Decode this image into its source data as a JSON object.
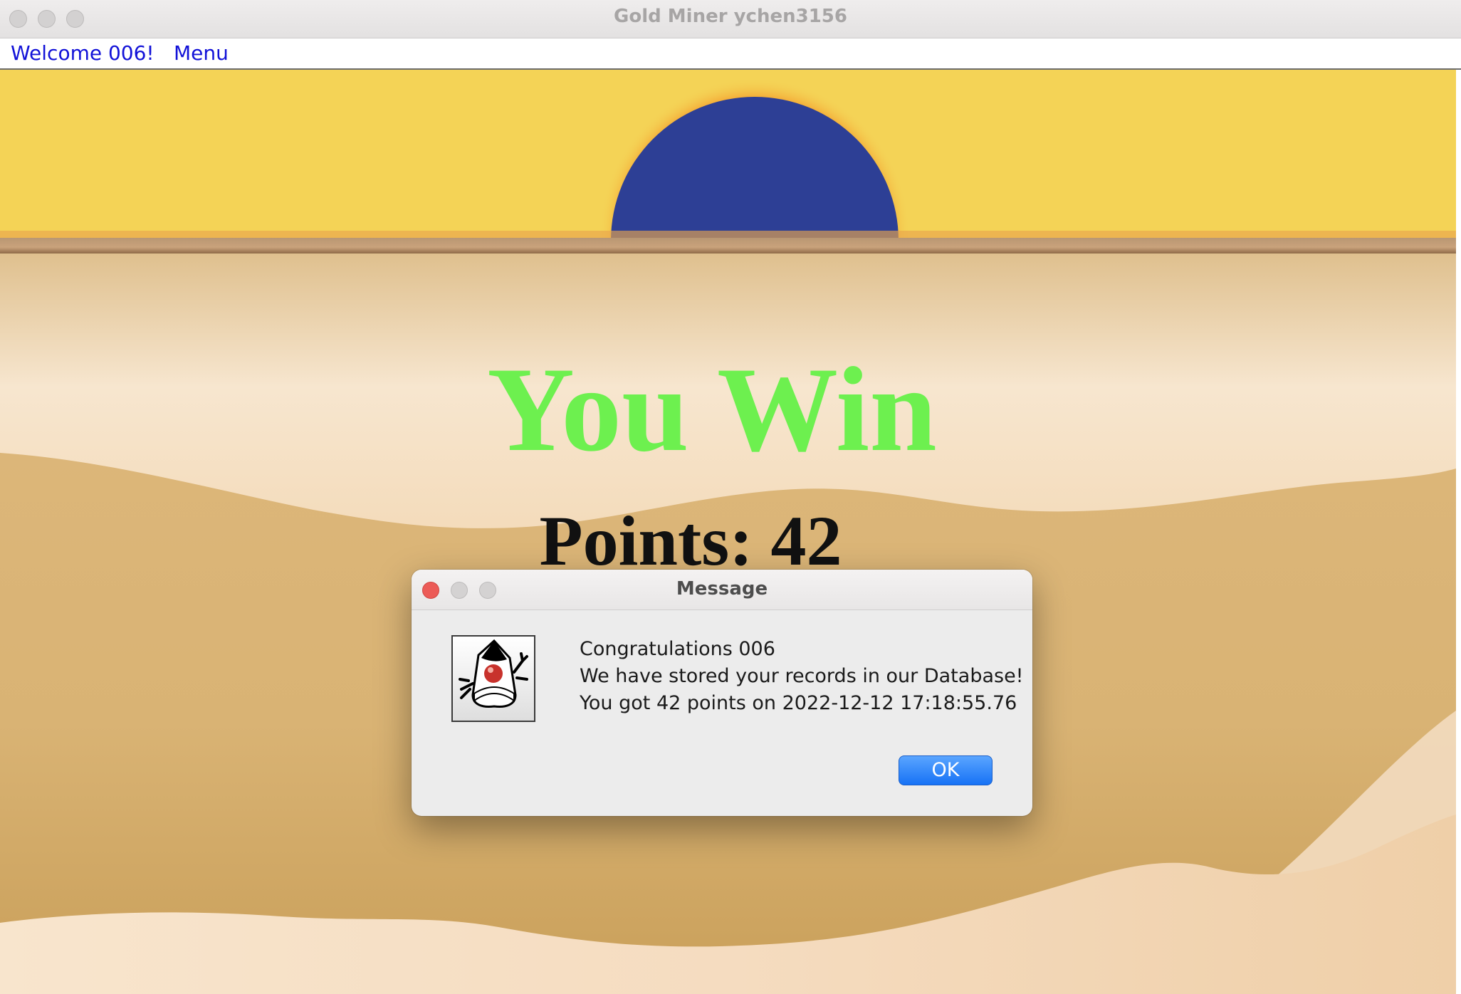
{
  "window": {
    "title": "Gold Miner ychen3156"
  },
  "menubar": {
    "items": [
      {
        "label": "Welcome 006!"
      },
      {
        "label": "Menu"
      }
    ]
  },
  "game": {
    "headline": "You Win",
    "points_text": "Points: 42",
    "points": 42
  },
  "dialog": {
    "title": "Message",
    "lines": [
      "Congratulations 006",
      "We have stored your records in our Database!",
      "You got 42 points on 2022-12-12 17:18:55.76"
    ],
    "ok_label": "OK",
    "icon": "java-duke-icon"
  },
  "colors": {
    "sky": "#f4d356",
    "sun": "#2d3f95",
    "headline": "#6df04f",
    "menu_text": "#1212d8",
    "ok_button": "#2f84f6"
  }
}
